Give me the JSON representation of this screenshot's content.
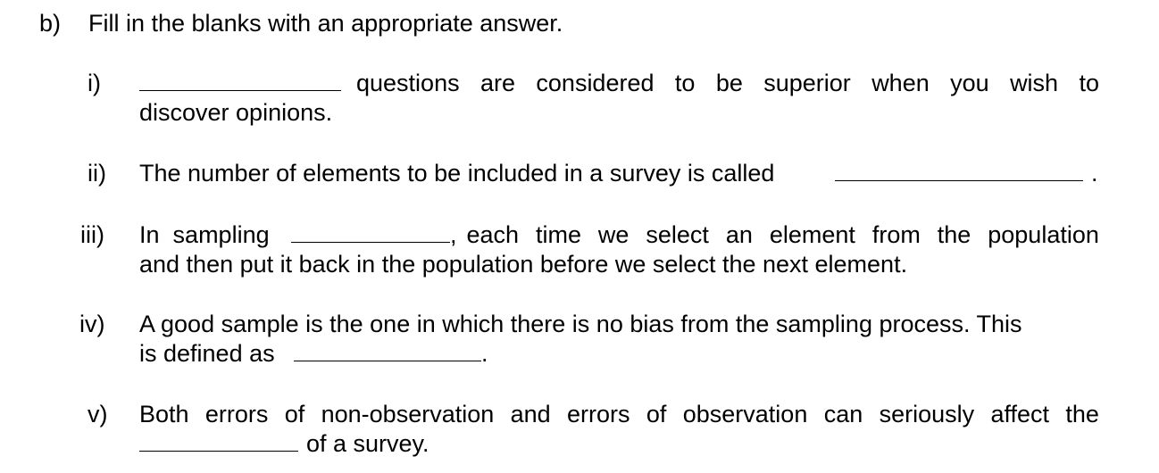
{
  "section": {
    "label": "b)",
    "instruction": "Fill in the blanks with an appropriate answer."
  },
  "questions": [
    {
      "number": "i)",
      "line1_words": [
        "questions",
        "are",
        "considered",
        "to",
        "be",
        "superior",
        "when",
        "you",
        "wish",
        "to"
      ],
      "line2": "discover opinions.",
      "answer": ""
    },
    {
      "number": "ii)",
      "text_before": "The number of elements to be included in a survey is called",
      "text_after": ".",
      "answer": ""
    },
    {
      "number": "iii)",
      "text_before_words": [
        "In",
        "sampling"
      ],
      "text_after_words": [
        ",",
        "each",
        "time",
        "we",
        "select",
        "an",
        "element",
        "from",
        "the",
        "population"
      ],
      "line2": "and then put it back in the population before we select the next element.",
      "answer": ""
    },
    {
      "number": "iv)",
      "line1": "A good sample is the one in which there is no bias from the sampling process. This",
      "line2_before": "is defined as",
      "line2_after": ".",
      "answer": ""
    },
    {
      "number": "v)",
      "line1_words": [
        "Both",
        "errors",
        "of",
        "non-observation",
        "and",
        "errors",
        "of",
        "observation",
        "can",
        "seriously",
        "affect",
        "the"
      ],
      "line2_after": "of a survey.",
      "answer": ""
    }
  ]
}
